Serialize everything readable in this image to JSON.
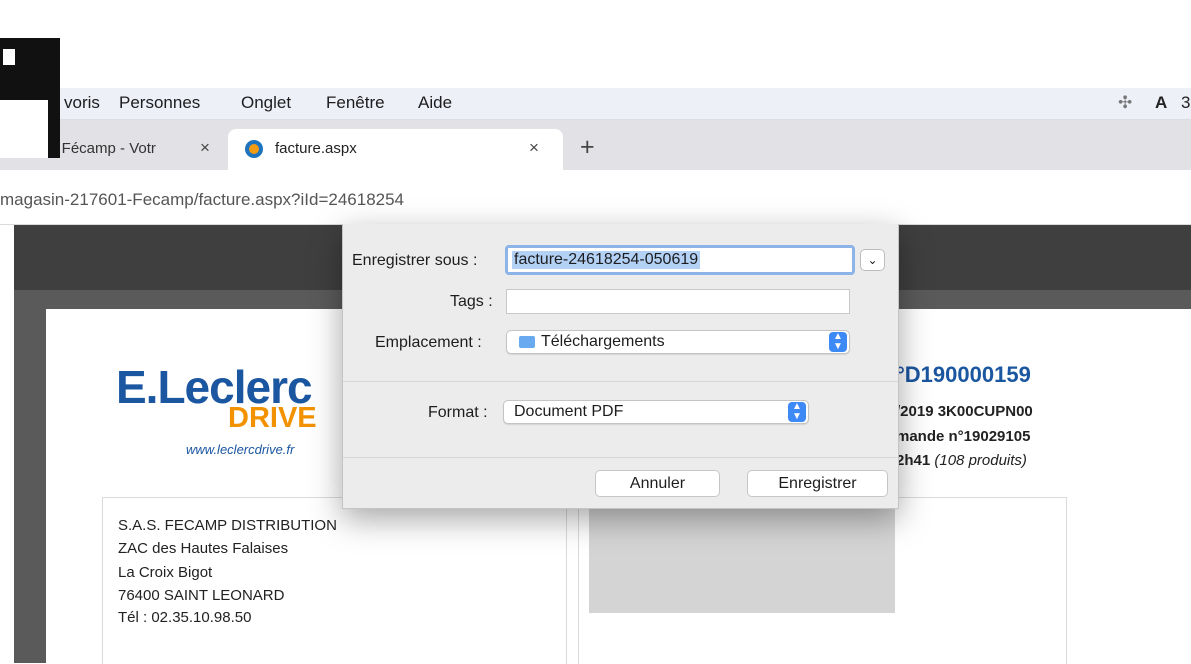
{
  "menubar": {
    "items": [
      "voris",
      "Personnes",
      "Onglet",
      "Fenêtre",
      "Aide"
    ],
    "tray": [
      "dropbox-icon",
      "adobe-icon"
    ],
    "tray_clip": "3"
  },
  "tabs": [
    {
      "title": "c DRIVE Fécamp - Votr",
      "close": "×",
      "active": false
    },
    {
      "title": "facture.aspx",
      "close": "×",
      "active": true,
      "favicon": "leclerc-favicon"
    }
  ],
  "new_tab": "+",
  "address": {
    "url": "magasin-217601-Fecamp/facture.aspx?iId=24618254"
  },
  "invoice": {
    "logo_title": "E.Leclerc",
    "logo_sub": "DRIVE",
    "logo_url": "www.leclercdrive.fr",
    "number": "°D190000159",
    "line2": "/2019 3K00CUPN00",
    "line3": "mande n°19029105",
    "line4_bold": "2h41",
    "line4_italic": "(108 produits)",
    "address_lines": [
      "S.A.S. FECAMP DISTRIBUTION",
      "ZAC des Hautes Falaises",
      "La Croix Bigot",
      "76400 SAINT LEONARD",
      "Tél : 02.35.10.98.50"
    ]
  },
  "dialog": {
    "save_as_label": "Enregistrer sous :",
    "filename": "facture-24618254-050619",
    "tags_label": "Tags :",
    "tags_value": "",
    "location_label": "Emplacement :",
    "location_value": "Téléchargements",
    "format_label": "Format :",
    "format_value": "Document PDF",
    "cancel": "Annuler",
    "save": "Enregistrer"
  },
  "colors": {
    "accent_blue": "#3d8af7",
    "leclerc_blue": "#1b56a0",
    "drive_orange": "#f39200"
  }
}
